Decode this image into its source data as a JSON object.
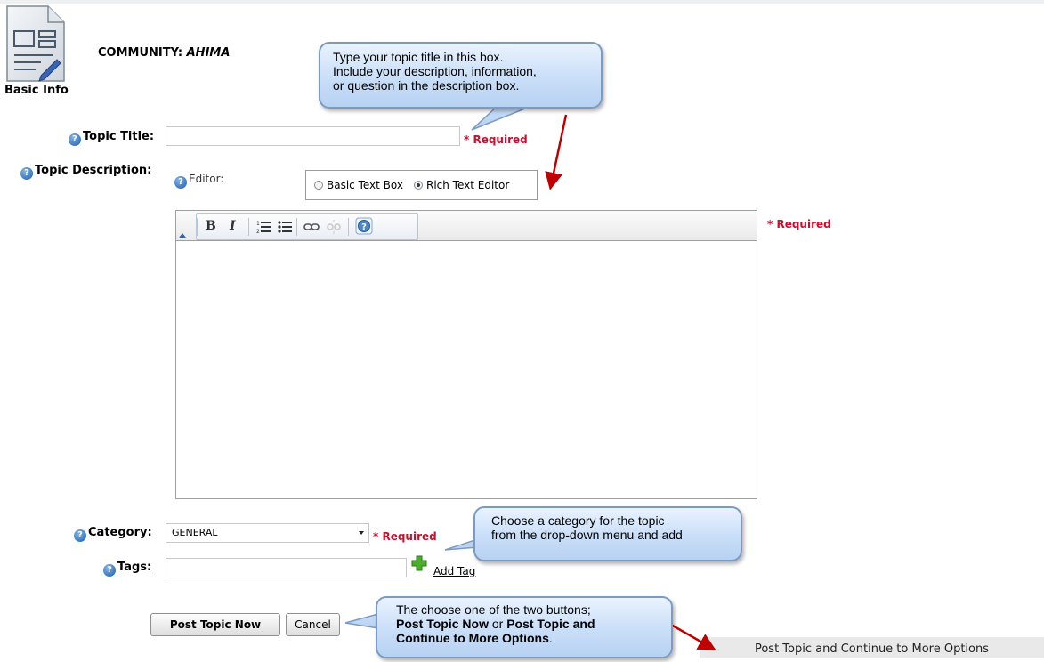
{
  "page": {
    "icon_label": "Basic Info",
    "community_prefix": "COMMUNITY:",
    "community_name": "AHIMA"
  },
  "form": {
    "topic_title_label": "Topic Title:",
    "topic_title_value": "",
    "topic_description_label": "Topic Description:",
    "editor_label": "Editor:",
    "editor_modes": [
      "Basic Text Box",
      "Rich Text Editor"
    ],
    "editor_mode_selected": "Rich Text Editor",
    "category_label": "Category:",
    "category_value": "GENERAL",
    "tags_label": "Tags:",
    "tags_value": "",
    "add_tag": "Add Tag",
    "required": "* Required"
  },
  "toolbar": {
    "bold": "B",
    "italic": "I"
  },
  "buttons": {
    "post_now": "Post Topic Now",
    "cancel": "Cancel",
    "post_more": "Post Topic and Continue to More Options"
  },
  "callouts": {
    "title": [
      "Type your topic title in this box.",
      "Include your description, information,",
      "or question in the description box."
    ],
    "category": [
      "Choose a category for the topic",
      "from the drop-down menu and add"
    ],
    "buttons": {
      "line1": "The choose one of the two buttons;",
      "b1": "Post Topic Now",
      "or": " or ",
      "b2": "Post Topic and",
      "line3_bold": "Continue to More Options",
      "line3_end": "."
    }
  },
  "colors": {
    "required": "#c8102e",
    "help_icon": "#1e5fae",
    "arrow": "#c00000"
  }
}
